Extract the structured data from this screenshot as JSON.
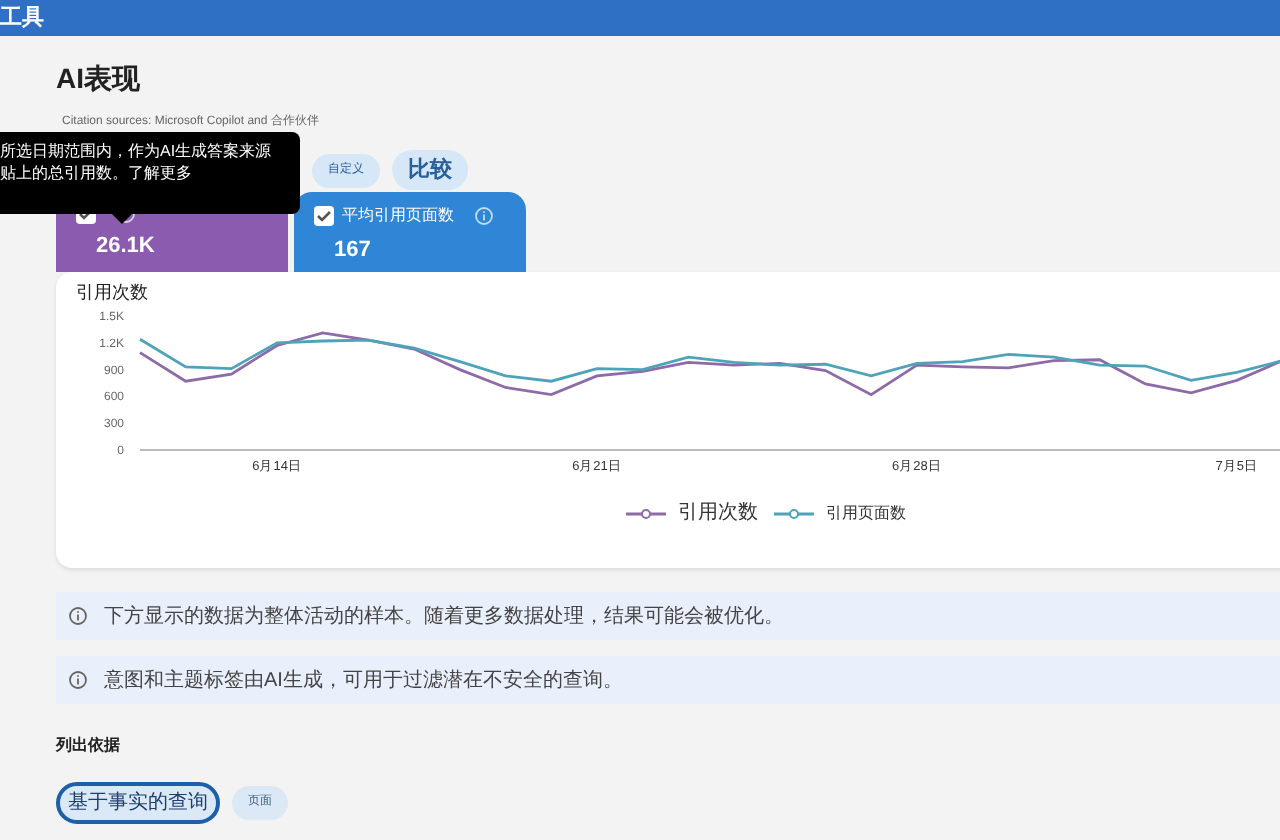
{
  "top_bar": {
    "title": "工具"
  },
  "page": {
    "title": "AI表现",
    "subtitle": "Citation sources: Microsoft Copilot and 合作伙伴"
  },
  "tooltip": {
    "lines": [
      "所选日期范围内，作为AI生成答案来源",
      "贴上的总引用数。了解更多"
    ]
  },
  "filters": [
    {
      "label": "自定义",
      "kind": "chip"
    },
    {
      "label": "比较",
      "kind": "button"
    }
  ],
  "metric_cards": [
    {
      "value": "26.1K",
      "checked": true,
      "color": "#8b5bb0"
    },
    {
      "label": "平均引用页面数",
      "value": "167",
      "checked": true,
      "color": "#2f86d6"
    }
  ],
  "chart": {
    "title": "引用次数",
    "chart_data": {
      "type": "line",
      "categories": [
        null,
        null,
        null,
        "6月14日",
        null,
        null,
        null,
        null,
        null,
        null,
        "6月21日",
        null,
        null,
        null,
        null,
        null,
        null,
        "6月28日",
        null,
        null,
        null,
        null,
        null,
        null,
        "7月5日",
        null
      ],
      "ylim": [
        0,
        1500
      ],
      "yticks": [
        {
          "value": 0,
          "label": "0"
        },
        {
          "value": 300,
          "label": "300"
        },
        {
          "value": 600,
          "label": "600"
        },
        {
          "value": 900,
          "label": "900"
        },
        {
          "value": 1200,
          "label": "1.2K"
        },
        {
          "value": 1500,
          "label": "1.5K"
        }
      ],
      "series": [
        {
          "name": "引用次数",
          "color": "#8e6ba8",
          "values": [
            1090,
            770,
            850,
            1170,
            1310,
            1230,
            1130,
            900,
            700,
            620,
            830,
            880,
            980,
            950,
            970,
            890,
            620,
            950,
            930,
            920,
            1000,
            1010,
            740,
            640,
            780,
            1000
          ]
        },
        {
          "name": "引用页面数",
          "color": "#4ea3b8",
          "values": [
            1240,
            930,
            910,
            1200,
            1220,
            1230,
            1140,
            990,
            830,
            770,
            910,
            900,
            1040,
            980,
            950,
            960,
            830,
            970,
            990,
            1070,
            1040,
            950,
            940,
            780,
            870,
            1000
          ]
        }
      ]
    }
  },
  "notices": [
    "下方显示的数据为整体活动的样本。随着更多数据处理，结果可能会被优化。",
    "意图和主题标签由AI生成，可用于过滤潜在不安全的查询。"
  ],
  "section": {
    "title": "列出依据",
    "chips": [
      {
        "label": "基于事实的查询",
        "selected": true
      },
      {
        "label": "页面",
        "selected": false
      }
    ]
  }
}
